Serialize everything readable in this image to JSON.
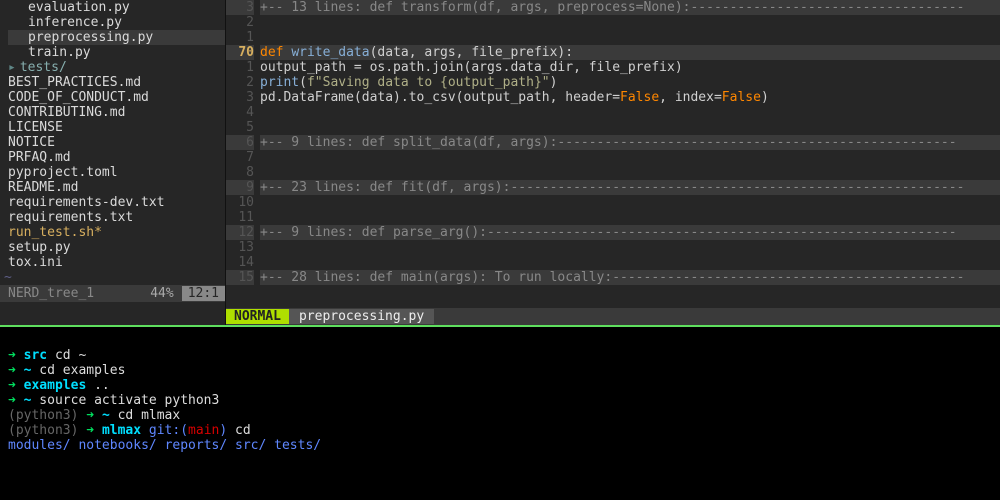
{
  "sidebar": {
    "items": [
      {
        "label": "evaluation.py",
        "indent": 1
      },
      {
        "label": "inference.py",
        "indent": 1
      },
      {
        "label": "preprocessing.py",
        "indent": 1,
        "sel": true
      },
      {
        "label": "train.py",
        "indent": 1
      },
      {
        "label": "tests/",
        "dir": true,
        "tri": "▸"
      },
      {
        "label": "BEST_PRACTICES.md"
      },
      {
        "label": "CODE_OF_CONDUCT.md"
      },
      {
        "label": "CONTRIBUTING.md"
      },
      {
        "label": "LICENSE"
      },
      {
        "label": "NOTICE"
      },
      {
        "label": "PRFAQ.md"
      },
      {
        "label": "pyproject.toml"
      },
      {
        "label": "README.md"
      },
      {
        "label": "requirements-dev.txt"
      },
      {
        "label": "requirements.txt"
      },
      {
        "label": "run_test.sh*",
        "golden": true
      },
      {
        "label": "setup.py"
      },
      {
        "label": "tox.ini"
      }
    ],
    "status": {
      "name": "NERD_tree_1",
      "pct": "44%",
      "pos": "12:1"
    }
  },
  "editor": {
    "lines": [
      {
        "g": "3",
        "fold": true,
        "txt": "+-- 13 lines: def transform(df, args, preprocess=None):"
      },
      {
        "g": "2",
        "txt": ""
      },
      {
        "g": "1",
        "txt": ""
      },
      {
        "g": "70",
        "cur": true,
        "tokens": [
          {
            "t": "def ",
            "c": "kw"
          },
          {
            "t": "write_data",
            "c": "fn"
          },
          {
            "t": "(data, args, file_prefix):",
            "c": "punct"
          }
        ]
      },
      {
        "g": "1",
        "tokens": [
          {
            "t": "    output_path = os.path.join(args.data_dir, file_prefix)",
            "c": "punct"
          }
        ]
      },
      {
        "g": "2",
        "tokens": [
          {
            "t": "    ",
            "c": "punct"
          },
          {
            "t": "print",
            "c": "fn"
          },
          {
            "t": "(",
            "c": "punct"
          },
          {
            "t": "f\"Saving data to {output_path}\"",
            "c": "str"
          },
          {
            "t": ")",
            "c": "punct"
          }
        ]
      },
      {
        "g": "3",
        "tokens": [
          {
            "t": "    pd.DataFrame(data).to_csv(output_path, header=",
            "c": "punct"
          },
          {
            "t": "False",
            "c": "bool"
          },
          {
            "t": ", index=",
            "c": "punct"
          },
          {
            "t": "False",
            "c": "bool"
          },
          {
            "t": ")",
            "c": "punct"
          }
        ]
      },
      {
        "g": "4",
        "txt": ""
      },
      {
        "g": "5",
        "txt": ""
      },
      {
        "g": "6",
        "fold": true,
        "txt": "+--  9 lines: def split_data(df, args):"
      },
      {
        "g": "7",
        "txt": ""
      },
      {
        "g": "8",
        "txt": ""
      },
      {
        "g": "9",
        "fold": true,
        "txt": "+-- 23 lines: def fit(df, args):"
      },
      {
        "g": "10",
        "txt": ""
      },
      {
        "g": "11",
        "txt": ""
      },
      {
        "g": "12",
        "fold": true,
        "txt": "+--  9 lines: def parse_arg():"
      },
      {
        "g": "13",
        "txt": ""
      },
      {
        "g": "14",
        "txt": ""
      },
      {
        "g": "15",
        "fold": true,
        "txt": "+-- 28 lines: def main(args): To run locally:"
      }
    ],
    "status": {
      "mode": "NORMAL",
      "file": "preprocessing.py"
    }
  },
  "terminal": {
    "lines": [
      [
        {
          "t": "➜  ",
          "c": "arrow"
        },
        {
          "t": "src",
          "c": "pathc"
        },
        {
          "t": " cd ~"
        }
      ],
      [
        {
          "t": "➜  ",
          "c": "arrow"
        },
        {
          "t": "~",
          "c": "pathc"
        },
        {
          "t": " cd examples"
        }
      ],
      [
        {
          "t": "➜  ",
          "c": "arrow"
        },
        {
          "t": "examples",
          "c": "pathc"
        },
        {
          "t": " .."
        }
      ],
      [
        {
          "t": "➜  ",
          "c": "arrow"
        },
        {
          "t": "~",
          "c": "pathc"
        },
        {
          "t": " source activate python3"
        }
      ],
      [
        {
          "t": "(python3) ",
          "c": "muted"
        },
        {
          "t": "➜  ",
          "c": "arrow"
        },
        {
          "t": "~",
          "c": "pathc"
        },
        {
          "t": " cd mlmax"
        }
      ],
      [
        {
          "t": "(python3) ",
          "c": "muted"
        },
        {
          "t": "➜  ",
          "c": "arrow"
        },
        {
          "t": "mlmax",
          "c": "pathc"
        },
        {
          "t": " "
        },
        {
          "t": "git:(",
          "c": "gitc"
        },
        {
          "t": "main",
          "c": "gitb"
        },
        {
          "t": ")",
          "c": "gitc"
        },
        {
          "t": " cd"
        }
      ],
      [
        {
          "t": "modules/",
          "c": "dirc"
        },
        {
          "t": "    "
        },
        {
          "t": "notebooks/",
          "c": "dirc"
        },
        {
          "t": "  "
        },
        {
          "t": "reports/",
          "c": "dirc"
        },
        {
          "t": "    "
        },
        {
          "t": "src/",
          "c": "dirc"
        },
        {
          "t": "       "
        },
        {
          "t": "tests/",
          "c": "dirc"
        }
      ]
    ]
  }
}
